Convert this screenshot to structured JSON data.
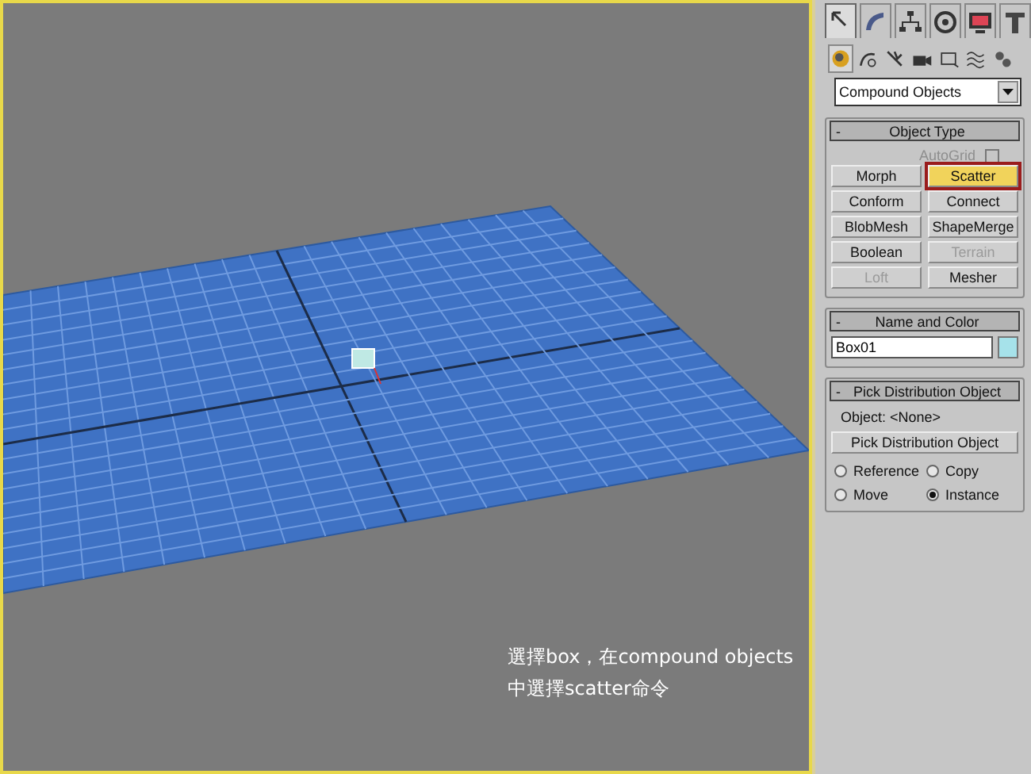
{
  "viewport": {
    "caption": [
      "選擇box，在compound objects",
      "中選擇scatter命令"
    ]
  },
  "command_panel": {
    "tabs": [
      {
        "kind": "create",
        "selected": true
      },
      {
        "kind": "modify",
        "selected": false
      },
      {
        "kind": "hierarchy",
        "selected": false
      },
      {
        "kind": "motion",
        "selected": false
      },
      {
        "kind": "display",
        "selected": false
      },
      {
        "kind": "utilities",
        "selected": false
      }
    ],
    "categories": [
      {
        "kind": "geometry",
        "selected": true
      },
      {
        "kind": "shapes",
        "selected": false
      },
      {
        "kind": "lights",
        "selected": false
      },
      {
        "kind": "cameras",
        "selected": false
      },
      {
        "kind": "helpers",
        "selected": false
      },
      {
        "kind": "spacewarps",
        "selected": false
      },
      {
        "kind": "systems",
        "selected": false
      }
    ],
    "dropdown": {
      "value": "Compound Objects"
    },
    "object_type": {
      "collapse": "-",
      "title": "Object Type",
      "autogrid": {
        "label": "AutoGrid",
        "checked": false,
        "disabled": true
      },
      "buttons": [
        {
          "label": "Morph",
          "selected": false,
          "disabled": false
        },
        {
          "label": "Scatter",
          "selected": true,
          "disabled": false
        },
        {
          "label": "Conform",
          "selected": false,
          "disabled": false
        },
        {
          "label": "Connect",
          "selected": false,
          "disabled": false
        },
        {
          "label": "BlobMesh",
          "selected": false,
          "disabled": false
        },
        {
          "label": "ShapeMerge",
          "selected": false,
          "disabled": false
        },
        {
          "label": "Boolean",
          "selected": false,
          "disabled": false
        },
        {
          "label": "Terrain",
          "selected": false,
          "disabled": true
        },
        {
          "label": "Loft",
          "selected": false,
          "disabled": true
        },
        {
          "label": "Mesher",
          "selected": false,
          "disabled": false
        }
      ]
    },
    "name_and_color": {
      "collapse": "-",
      "title": "Name and Color",
      "name": "Box01",
      "color": "#a6e2ea"
    },
    "pick_distribution": {
      "collapse": "-",
      "title": "Pick Distribution Object",
      "object_label": "Object: <None>",
      "button": "Pick Distribution Object",
      "radios": [
        {
          "label": "Reference",
          "selected": false
        },
        {
          "label": "Copy",
          "selected": false
        },
        {
          "label": "Move",
          "selected": false
        },
        {
          "label": "Instance",
          "selected": true
        }
      ]
    }
  }
}
